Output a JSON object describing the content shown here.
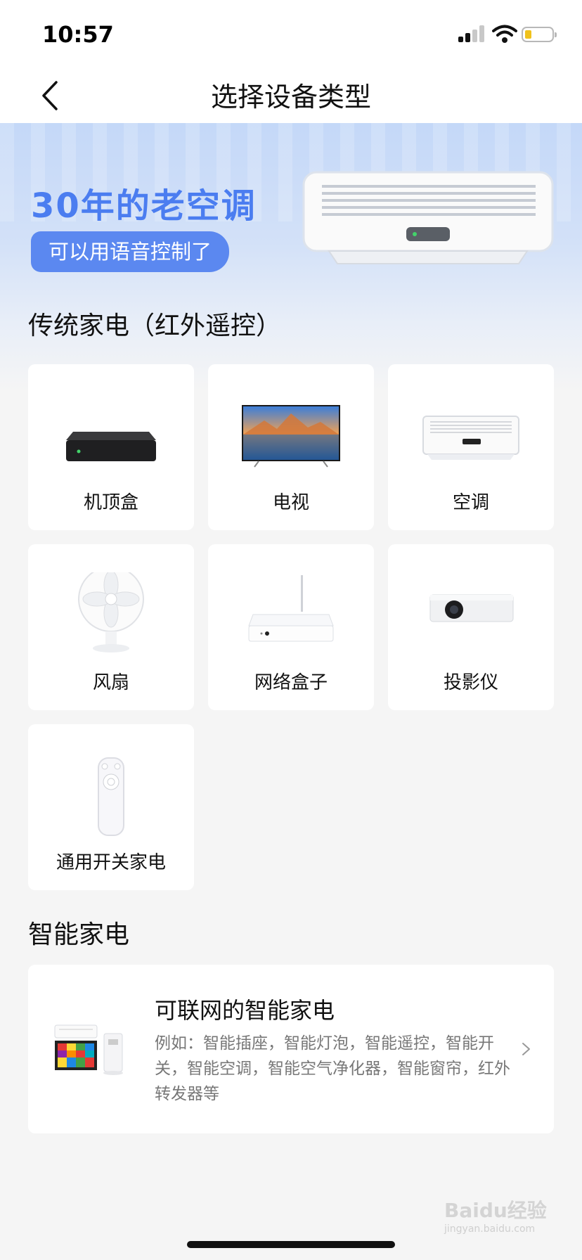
{
  "status_bar": {
    "time": "10:57"
  },
  "nav": {
    "title": "选择设备类型"
  },
  "banner": {
    "headline": "30年的老空调",
    "pill": "可以用语音控制了"
  },
  "section_traditional": {
    "title": "传统家电（红外遥控）"
  },
  "devices": [
    {
      "label": "机顶盒",
      "icon": "set-top-box-icon"
    },
    {
      "label": "电视",
      "icon": "tv-icon"
    },
    {
      "label": "空调",
      "icon": "air-conditioner-icon"
    },
    {
      "label": "风扇",
      "icon": "fan-icon"
    },
    {
      "label": "网络盒子",
      "icon": "network-box-icon"
    },
    {
      "label": "投影仪",
      "icon": "projector-icon"
    },
    {
      "label": "通用开关家电",
      "icon": "remote-control-icon"
    }
  ],
  "section_smart": {
    "title": "智能家电"
  },
  "smart_card": {
    "title": "可联网的智能家电",
    "description": "例如：智能插座，智能灯泡，智能遥控，智能开关，智能空调，智能空气净化器，智能窗帘，红外转发器等",
    "icon": "smart-appliances-icon"
  },
  "watermark": {
    "text": "Baidu经验",
    "subtext": "jingyan.baidu.com"
  },
  "colors": {
    "accent": "#4b7df0",
    "pill": "#5b88f0",
    "background": "#f5f5f5"
  }
}
